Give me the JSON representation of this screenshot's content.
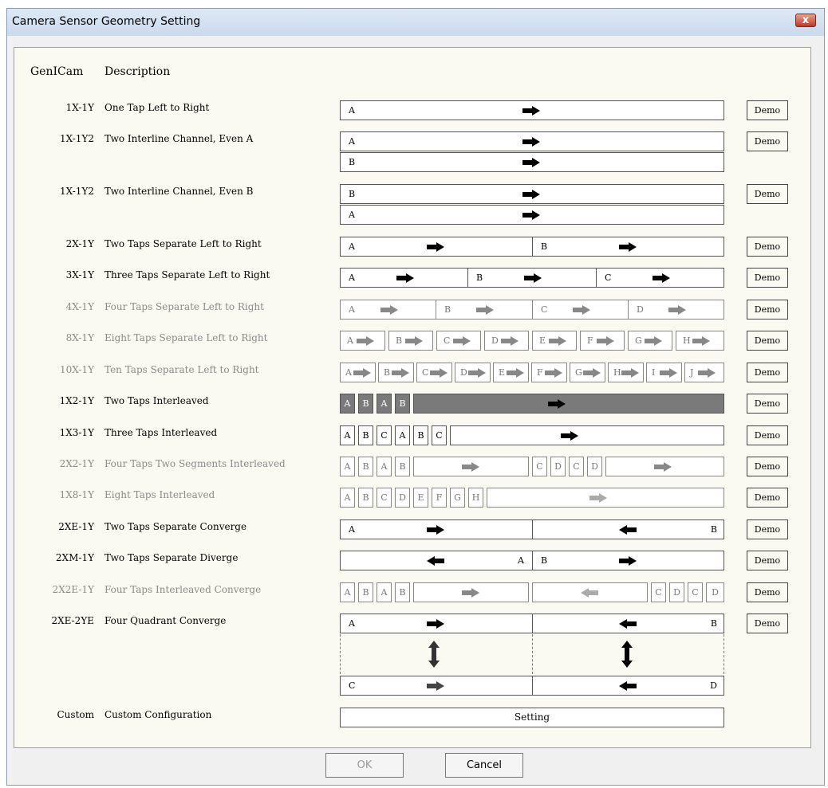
{
  "window": {
    "title": "Camera Sensor Geometry Setting",
    "close_label": "x"
  },
  "header": {
    "col1": "GenICam",
    "col2": "Description"
  },
  "demo_label": "Demo",
  "rows": [
    {
      "genicam": "1X-1Y",
      "description": "One Tap Left to Right",
      "enabled": true
    },
    {
      "genicam": "1X-1Y2",
      "description": "Two Interline Channel, Even A",
      "enabled": true
    },
    {
      "genicam": "1X-1Y2",
      "description": "Two Interline Channel, Even B",
      "enabled": true
    },
    {
      "genicam": "2X-1Y",
      "description": "Two Taps Separate Left to Right",
      "enabled": true
    },
    {
      "genicam": "3X-1Y",
      "description": "Three Taps Separate Left to Right",
      "enabled": true
    },
    {
      "genicam": "4X-1Y",
      "description": "Four Taps Separate Left to Right",
      "enabled": false
    },
    {
      "genicam": "8X-1Y",
      "description": "Eight Taps Separate Left to Right",
      "enabled": false
    },
    {
      "genicam": "10X-1Y",
      "description": "Ten Taps Separate Left to Right",
      "enabled": false
    },
    {
      "genicam": "1X2-1Y",
      "description": "Two Taps Interleaved",
      "enabled": true
    },
    {
      "genicam": "1X3-1Y",
      "description": "Three Taps Interleaved",
      "enabled": true
    },
    {
      "genicam": "2X2-1Y",
      "description": "Four Taps Two Segments Interleaved",
      "enabled": false
    },
    {
      "genicam": "1X8-1Y",
      "description": "Eight Taps Interleaved",
      "enabled": false
    },
    {
      "genicam": "2XE-1Y",
      "description": "Two Taps Separate Converge",
      "enabled": true
    },
    {
      "genicam": "2XM-1Y",
      "description": "Two Taps Separate Diverge",
      "enabled": true
    },
    {
      "genicam": "2X2E-1Y",
      "description": "Four Taps Interleaved Converge",
      "enabled": false
    },
    {
      "genicam": "2XE-2YE",
      "description": "Four Quadrant Converge",
      "enabled": true
    },
    {
      "genicam": "Custom",
      "description": "Custom Configuration",
      "enabled": true
    }
  ],
  "taps": {
    "a": "A",
    "b": "B",
    "c": "C",
    "d": "D",
    "e": "E",
    "f": "F",
    "g": "G",
    "h": "H",
    "i": "I",
    "j": "J"
  },
  "custom": {
    "setting_label": "Setting"
  },
  "buttons": {
    "ok": "OK",
    "cancel": "Cancel"
  }
}
